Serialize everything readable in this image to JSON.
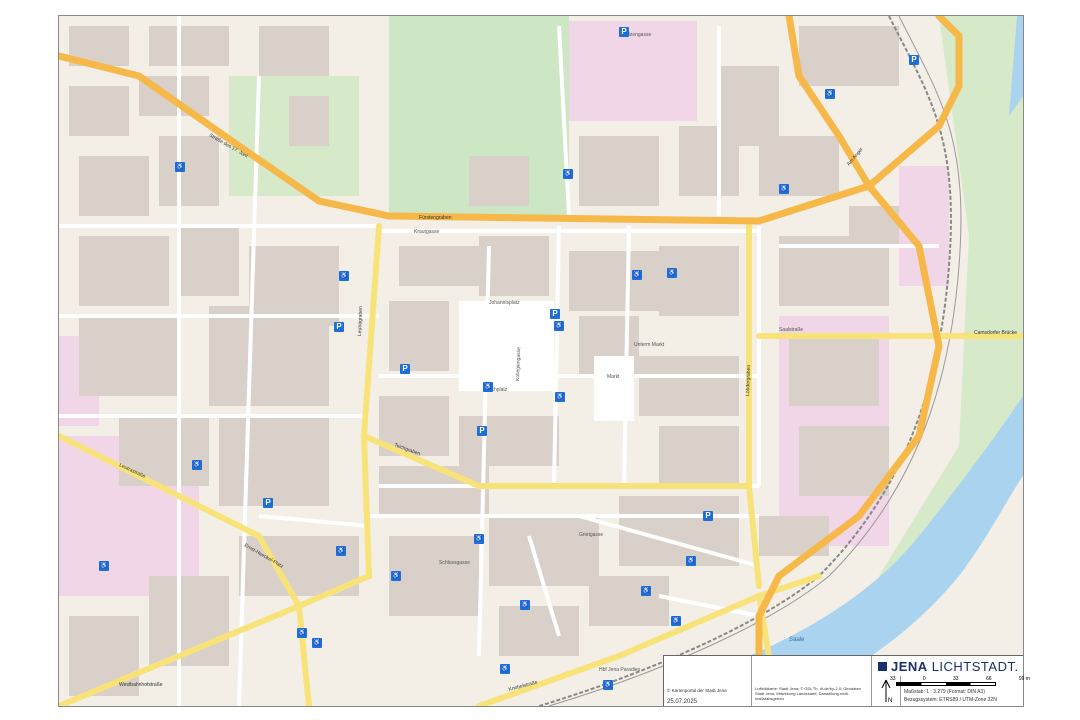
{
  "map": {
    "streets": {
      "lobdergraben": "Löbdergraben",
      "leutragraben": "Leutragraben",
      "teichgraben": "Teichgraben",
      "fuerstengraben": "Fürstengraben",
      "loebdergraben_b": "Löbdergraben",
      "johannisplatz": "Johannisplatz",
      "eichplatz": "Eichplatz",
      "markt": "Markt",
      "unterm_markt": "Unterm Markt",
      "kollegiengasse": "Kollegiengasse",
      "schlossgasse": "Schlossgasse",
      "saalstrasse": "Saalstraße",
      "camsdorfer_bruecke": "Camsdorfer Brücke",
      "ernst_haeckel_platz": "Ernst-Haeckel-Platz",
      "leutrastrasse": "Leutrastraße",
      "westbahnhofstrasse": "Westbahnhofstraße",
      "knebelstrasse": "Knebelstraße",
      "saale": "Saale",
      "jena_paradies": "Hbf Jena Paradies",
      "strasse_17_juni": "Straße des 17. Juni",
      "krautgasse": "Krautgasse",
      "am_anger": "Am Anger",
      "grietgasse": "Grietgasse",
      "zwaetzengasse": "Zwätzengasse"
    },
    "colors": {
      "land": "#f3efe6",
      "building": "#d9d0c9",
      "main_road": "#f7b84a",
      "secondary_road": "#f8e37a",
      "minor_road": "#ffffff",
      "water": "#a9d3ee",
      "park": "#cde6c3",
      "residential_pink": "#f0d6e6",
      "rail": "#999999",
      "parking": "#1d6fd6"
    },
    "parking_icons": {
      "parking": "P",
      "accessible": "♿"
    }
  },
  "info_panel": {
    "copyright": "© Kartenportal der Stadt Jena",
    "date": "25.07.2025",
    "data_sources": "Luftbildkarte: Stadt Jena; © GDI-Th, dl-de/by-2-0; Geodaten Stadt Jena; Mitwirkung Landesamt; Darstellung nicht maßstabsgetreu",
    "logo_jena": "JENA",
    "logo_lichtstadt": "LICHTSTADT.",
    "scale_ticks": [
      "33",
      "0",
      "33",
      "66",
      "99 m"
    ],
    "scale_text": "Maßstab: 1 : 3.279 (Format: DIN A3)",
    "crs_text": "Bezugssystem: ETRS89 / UTM-Zone 32N",
    "north_arrow": "N"
  }
}
